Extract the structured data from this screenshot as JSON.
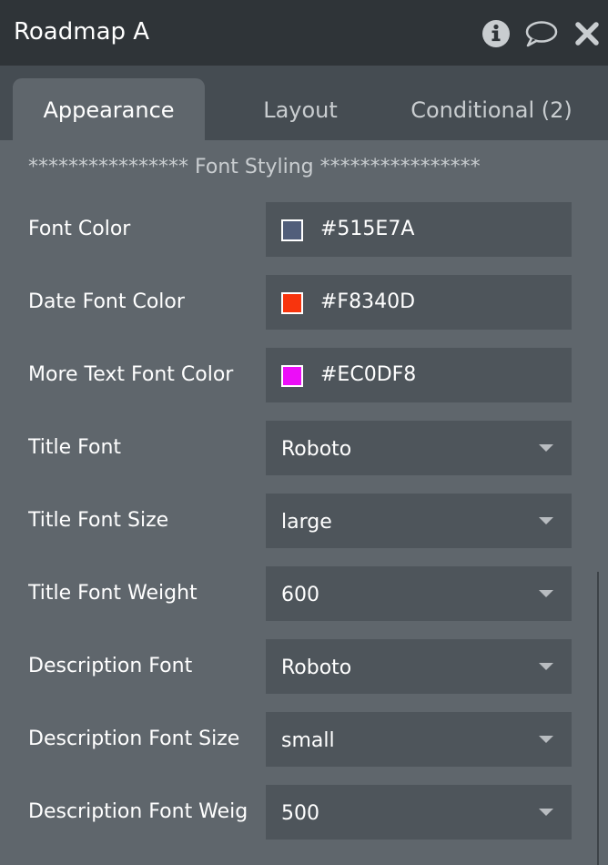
{
  "window": {
    "title": "Roadmap A",
    "icons": [
      "info-icon",
      "comment-icon",
      "close-icon"
    ]
  },
  "tabs": [
    {
      "label": "Appearance",
      "active": true
    },
    {
      "label": "Layout",
      "active": false
    },
    {
      "label": "Conditional (2)",
      "active": false
    }
  ],
  "section": {
    "title": "**************** Font Styling ****************"
  },
  "color_fields": [
    {
      "label": "Font Color",
      "value": "#515E7A",
      "swatch": "#515E7A"
    },
    {
      "label": "Date Font Color",
      "value": "#F8340D",
      "swatch": "#F8340D"
    },
    {
      "label": "More Text Font Color",
      "value": "#EC0DF8",
      "swatch": "#EC0DF8"
    }
  ],
  "select_fields": [
    {
      "label": "Title Font",
      "value": "Roboto"
    },
    {
      "label": "Title Font Size",
      "value": "large"
    },
    {
      "label": "Title Font Weight",
      "value": "600"
    },
    {
      "label": "Description Font",
      "value": "Roboto"
    },
    {
      "label": "Description Font Size",
      "value": "small"
    },
    {
      "label": "Description Font Weig",
      "value": "500"
    }
  ],
  "colors": {
    "header_bg": "#2F3438",
    "tabbar_bg": "#454C52",
    "panel_bg": "#5F666C",
    "field_bg": "#4E555B"
  }
}
